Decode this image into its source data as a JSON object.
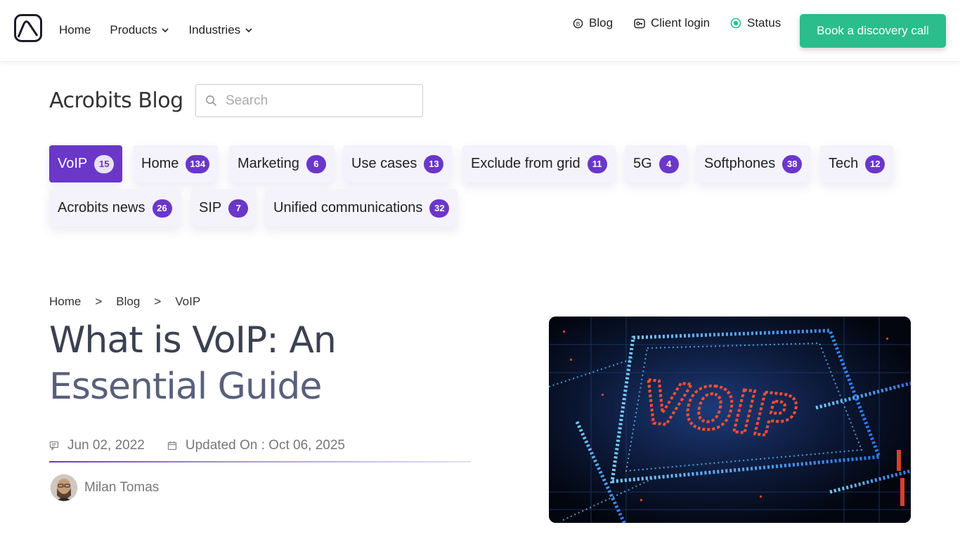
{
  "nav": {
    "logo": "acrobits-logo",
    "left_items": [
      {
        "label": "Home",
        "has_dropdown": false
      },
      {
        "label": "Products",
        "has_dropdown": true
      },
      {
        "label": "Industries",
        "has_dropdown": true
      }
    ],
    "right_items": [
      {
        "label": "Blog",
        "icon": "blog-icon"
      },
      {
        "label": "Client login",
        "icon": "key-icon"
      },
      {
        "label": "Status",
        "icon": "status-icon"
      }
    ],
    "cta_label": "Book a discovery call",
    "cta_color": "#2bbd8c",
    "status_color": "#2bbd8c"
  },
  "blog": {
    "title": "Acrobits Blog",
    "search_placeholder": "Search",
    "search_value": ""
  },
  "tags": [
    {
      "label": "VoIP",
      "count": "15",
      "active": true
    },
    {
      "label": "Home",
      "count": "134",
      "active": false
    },
    {
      "label": "Marketing",
      "count": "6",
      "active": false
    },
    {
      "label": "Use cases",
      "count": "13",
      "active": false
    },
    {
      "label": "Exclude from grid",
      "count": "11",
      "active": false
    },
    {
      "label": "5G",
      "count": "4",
      "active": false
    },
    {
      "label": "Softphones",
      "count": "38",
      "active": false
    },
    {
      "label": "Tech",
      "count": "12",
      "active": false
    },
    {
      "label": "Acrobits news",
      "count": "26",
      "active": false
    },
    {
      "label": "SIP",
      "count": "7",
      "active": false
    },
    {
      "label": "Unified communications",
      "count": "32",
      "active": false
    }
  ],
  "accent_color": "#6a37c9",
  "breadcrumb": {
    "items": [
      "Home",
      "Blog",
      "VoIP"
    ],
    "separator": ">"
  },
  "article": {
    "title_line1": "What is VoIP: An",
    "title_line2": "Essential Guide",
    "published": "Jun 02, 2022",
    "updated": "Updated On : Oct 06, 2025",
    "author": "Milan Tomas",
    "hero_text": "VOIP"
  }
}
